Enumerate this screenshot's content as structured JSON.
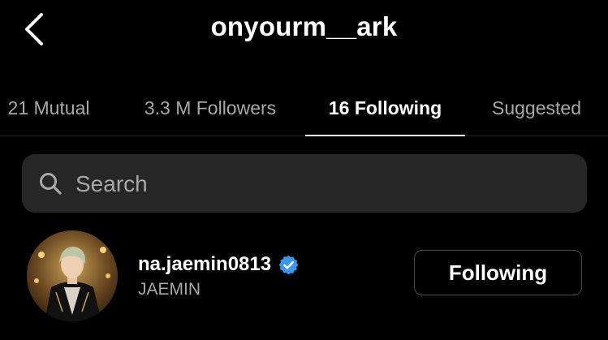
{
  "header": {
    "title": "onyourm__ark",
    "back_icon": "chevron-left-icon"
  },
  "tabs": [
    {
      "label": "21 Mutual",
      "active": false
    },
    {
      "label": "3.3 M Followers",
      "active": false
    },
    {
      "label": "16 Following",
      "active": true
    },
    {
      "label": "Suggested",
      "active": false
    }
  ],
  "search": {
    "placeholder": "Search",
    "value": "",
    "icon": "search-icon"
  },
  "list": [
    {
      "username": "na.jaemin0813",
      "full_name": "JAEMIN",
      "verified": true,
      "button_label": "Following"
    }
  ],
  "colors": {
    "background": "#000000",
    "text_primary": "#ffffff",
    "text_secondary": "#a8a8a8",
    "search_bg": "#262626",
    "verified_blue": "#3897f0"
  }
}
